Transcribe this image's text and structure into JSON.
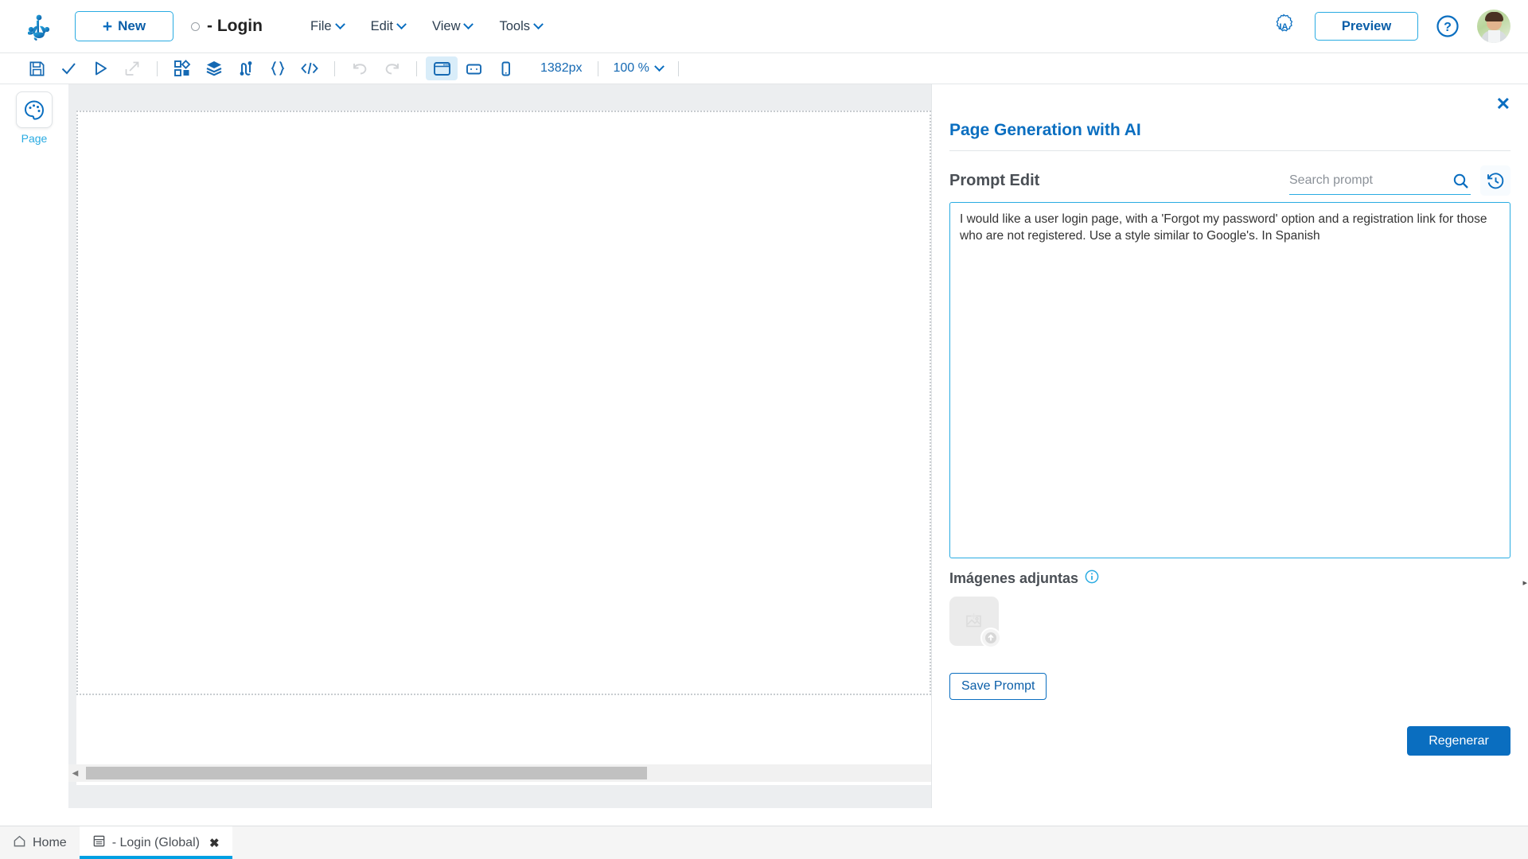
{
  "app": {
    "logo_icon": "frog-logo-icon",
    "new_button": "New",
    "document_title": "- Login",
    "menus": [
      "File",
      "Edit",
      "View",
      "Tools"
    ],
    "ia_badge": "IA",
    "preview_button": "Preview",
    "help_icon": "question-circle-icon",
    "avatar": "user-avatar"
  },
  "toolbar": {
    "icons": [
      {
        "name": "save-icon",
        "state": "enabled"
      },
      {
        "name": "check-icon",
        "state": "enabled"
      },
      {
        "name": "play-icon",
        "state": "enabled"
      },
      {
        "name": "external-link-icon",
        "state": "disabled"
      },
      {
        "name": "components-icon",
        "state": "enabled"
      },
      {
        "name": "layers-icon",
        "state": "enabled"
      },
      {
        "name": "connections-icon",
        "state": "enabled"
      },
      {
        "name": "braces-icon",
        "state": "enabled"
      },
      {
        "name": "code-icon",
        "state": "enabled"
      },
      {
        "name": "undo-icon",
        "state": "disabled"
      },
      {
        "name": "redo-icon",
        "state": "disabled"
      },
      {
        "name": "desktop-view-icon",
        "state": "active"
      },
      {
        "name": "tablet-view-icon",
        "state": "enabled"
      },
      {
        "name": "mobile-view-icon",
        "state": "enabled"
      }
    ],
    "width_value": "1382px",
    "zoom_value": "100 %"
  },
  "left_rail": {
    "page_tool_icon": "palette-icon",
    "page_tool_label": "Page"
  },
  "ai_panel": {
    "close_label": "✕",
    "title": "Page Generation with AI",
    "prompt_edit_label": "Prompt Edit",
    "search_placeholder": "Search prompt",
    "search_value": "",
    "search_icon": "magnifier-icon",
    "history_icon": "history-clock-icon",
    "prompt_text": "I would like a user login page, with a 'Forgot my password' option and a registration link for those who are not registered. Use a style similar to Google's. In Spanish",
    "attachments_label": "Imágenes adjuntas",
    "attachments_info_icon": "info-circle-icon",
    "attachment_upload_icon": "image-upload-icon",
    "save_prompt_button": "Save Prompt",
    "regenerate_button": "Regenerar"
  },
  "bottom_bar": {
    "tabs": [
      {
        "label": "Home",
        "icon": "home-icon",
        "active": false,
        "closable": false
      },
      {
        "label": "- Login (Global)",
        "icon": "page-file-icon",
        "active": true,
        "closable": true,
        "close_label": "✖"
      }
    ]
  },
  "colors": {
    "brand_blue": "#0a6ec0",
    "accent_cyan": "#29abe2",
    "tab_underline": "#00a0e3",
    "canvas_bg": "#eceef0"
  }
}
